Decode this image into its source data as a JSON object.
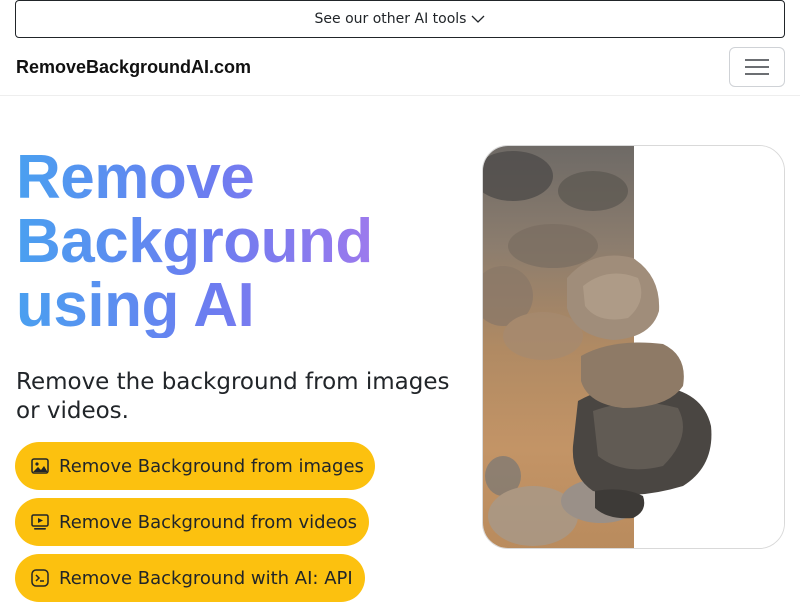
{
  "banner": {
    "label": "See our other AI tools"
  },
  "navbar": {
    "brand": "RemoveBackgroundAI.com"
  },
  "hero": {
    "title_lines": [
      "Remove",
      "Background",
      "using AI"
    ],
    "subtitle": "Remove the background from images or videos."
  },
  "actions": [
    {
      "label": "Remove Background from images",
      "icon": "image-icon"
    },
    {
      "label": "Remove Background from videos",
      "icon": "video-icon"
    },
    {
      "label": "Remove Background with AI: API",
      "icon": "terminal-icon"
    }
  ],
  "colors": {
    "cta": "#fcc10f",
    "gradient_start": "#4aa0f0",
    "gradient_end": "#a879ec"
  }
}
